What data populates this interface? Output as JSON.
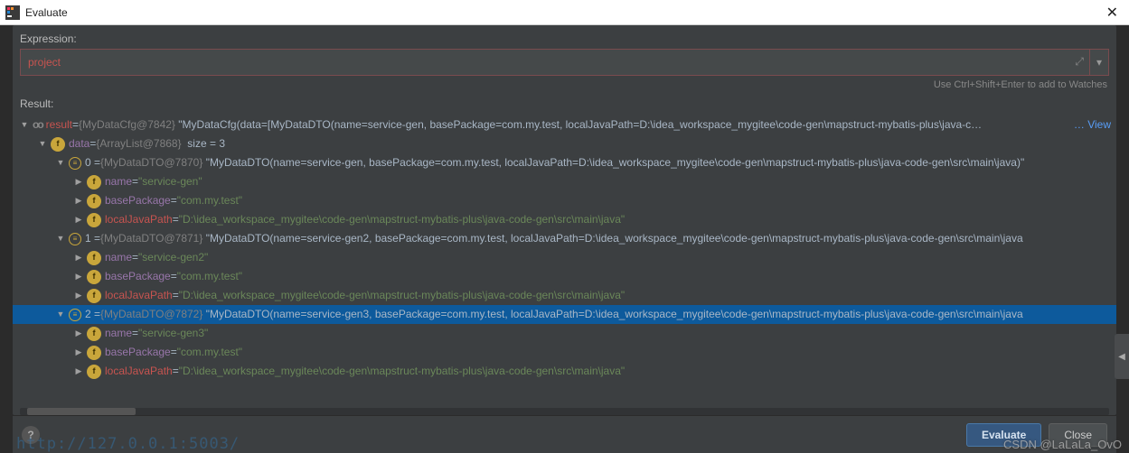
{
  "window": {
    "title": "Evaluate"
  },
  "labels": {
    "expression": "Expression:",
    "result": "Result:",
    "hint": "Use Ctrl+Shift+Enter to add to Watches"
  },
  "expression": {
    "value": "project"
  },
  "tree": {
    "result_name": "result",
    "result_type": "{MyDataCfg@7842}",
    "result_tostring": "\"MyDataCfg(data=[MyDataDTO(name=service-gen, basePackage=com.my.test, localJavaPath=D:\\idea_workspace_mygitee\\code-gen\\mapstruct-mybatis-plus\\java-c…",
    "view_label": "… View",
    "data_name": "data",
    "data_type": "{ArrayList@7868}",
    "data_size": "size = 3",
    "items": [
      {
        "index": "0",
        "type": "{MyDataDTO@7870}",
        "tostring": "\"MyDataDTO(name=service-gen, basePackage=com.my.test, localJavaPath=D:\\idea_workspace_mygitee\\code-gen\\mapstruct-mybatis-plus\\java-code-gen\\src\\main\\java)\"",
        "name_val": "\"service-gen\"",
        "basePackage_val": "\"com.my.test\"",
        "localJavaPath_val": "\"D:\\idea_workspace_mygitee\\code-gen\\mapstruct-mybatis-plus\\java-code-gen\\src\\main\\java\""
      },
      {
        "index": "1",
        "type": "{MyDataDTO@7871}",
        "tostring": "\"MyDataDTO(name=service-gen2, basePackage=com.my.test, localJavaPath=D:\\idea_workspace_mygitee\\code-gen\\mapstruct-mybatis-plus\\java-code-gen\\src\\main\\java",
        "name_val": "\"service-gen2\"",
        "basePackage_val": "\"com.my.test\"",
        "localJavaPath_val": "\"D:\\idea_workspace_mygitee\\code-gen\\mapstruct-mybatis-plus\\java-code-gen\\src\\main\\java\""
      },
      {
        "index": "2",
        "type": "{MyDataDTO@7872}",
        "tostring": "\"MyDataDTO(name=service-gen3, basePackage=com.my.test, localJavaPath=D:\\idea_workspace_mygitee\\code-gen\\mapstruct-mybatis-plus\\java-code-gen\\src\\main\\java",
        "name_val": "\"service-gen3\"",
        "basePackage_val": "\"com.my.test\"",
        "localJavaPath_val": "\"D:\\idea_workspace_mygitee\\code-gen\\mapstruct-mybatis-plus\\java-code-gen\\src\\main\\java\""
      }
    ],
    "field_name": "name",
    "field_basePackage": "basePackage",
    "field_localJavaPath": "localJavaPath"
  },
  "buttons": {
    "evaluate": "Evaluate",
    "close": "Close"
  },
  "watermark": "CSDN @LaLaLa_OvO",
  "background_url": "http://127.0.0.1:5003/"
}
